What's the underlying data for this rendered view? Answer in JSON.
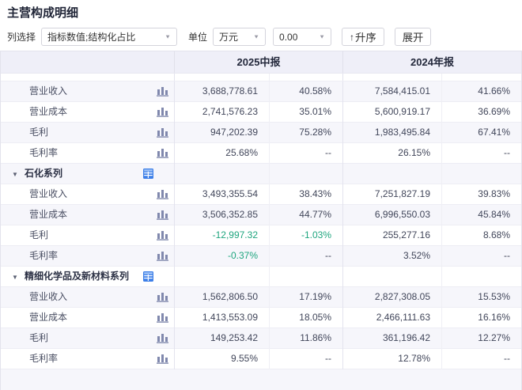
{
  "page": {
    "title": "主营构成明细"
  },
  "icons": {
    "chevron_down": "▼",
    "sort_arrow": "↑",
    "collapse_caret": "▼"
  },
  "toolbar": {
    "column_select_label": "列选择",
    "column_select_value": "指标数值;结构化占比",
    "unit_label": "单位",
    "unit_value": "万元",
    "decimal_value": "0.00",
    "sort_label": "升序",
    "expand_label": "展开"
  },
  "table": {
    "col_groups": [
      "2025中报",
      "2024年报"
    ],
    "rows": [
      {
        "type": "item",
        "label": "营业收入",
        "cells": [
          "3,688,778.61",
          "40.58%",
          "7,584,415.01",
          "41.66%"
        ]
      },
      {
        "type": "item",
        "label": "营业成本",
        "cells": [
          "2,741,576.23",
          "35.01%",
          "5,600,919.17",
          "36.69%"
        ]
      },
      {
        "type": "item",
        "label": "毛利",
        "cells": [
          "947,202.39",
          "75.28%",
          "1,983,495.84",
          "67.41%"
        ]
      },
      {
        "type": "item",
        "label": "毛利率",
        "cells": [
          "25.68%",
          "--",
          "26.15%",
          "--"
        ]
      },
      {
        "type": "section",
        "label": "石化系列",
        "cells": [
          "",
          "",
          "",
          ""
        ]
      },
      {
        "type": "item",
        "label": "营业收入",
        "cells": [
          "3,493,355.54",
          "38.43%",
          "7,251,827.19",
          "39.83%"
        ]
      },
      {
        "type": "item",
        "label": "营业成本",
        "cells": [
          "3,506,352.85",
          "44.77%",
          "6,996,550.03",
          "45.84%"
        ]
      },
      {
        "type": "item",
        "label": "毛利",
        "cells": [
          "-12,997.32",
          "-1.03%",
          "255,277.16",
          "8.68%"
        ]
      },
      {
        "type": "item",
        "label": "毛利率",
        "cells": [
          "-0.37%",
          "--",
          "3.52%",
          "--"
        ]
      },
      {
        "type": "section",
        "label": "精细化学品及新材料系列",
        "cells": [
          "",
          "",
          "",
          ""
        ]
      },
      {
        "type": "item",
        "label": "营业收入",
        "cells": [
          "1,562,806.50",
          "17.19%",
          "2,827,308.05",
          "15.53%"
        ]
      },
      {
        "type": "item",
        "label": "营业成本",
        "cells": [
          "1,413,553.09",
          "18.05%",
          "2,466,111.63",
          "16.16%"
        ]
      },
      {
        "type": "item",
        "label": "毛利",
        "cells": [
          "149,253.42",
          "11.86%",
          "361,196.42",
          "12.27%"
        ]
      },
      {
        "type": "item",
        "label": "毛利率",
        "cells": [
          "9.55%",
          "--",
          "12.78%",
          "--"
        ]
      }
    ]
  },
  "colors": {
    "negative_green": "#1ea57e",
    "accent_blue": "#3d7fe8",
    "header_bg": "#efeff8",
    "stripe_bg": "#f6f6fb"
  }
}
